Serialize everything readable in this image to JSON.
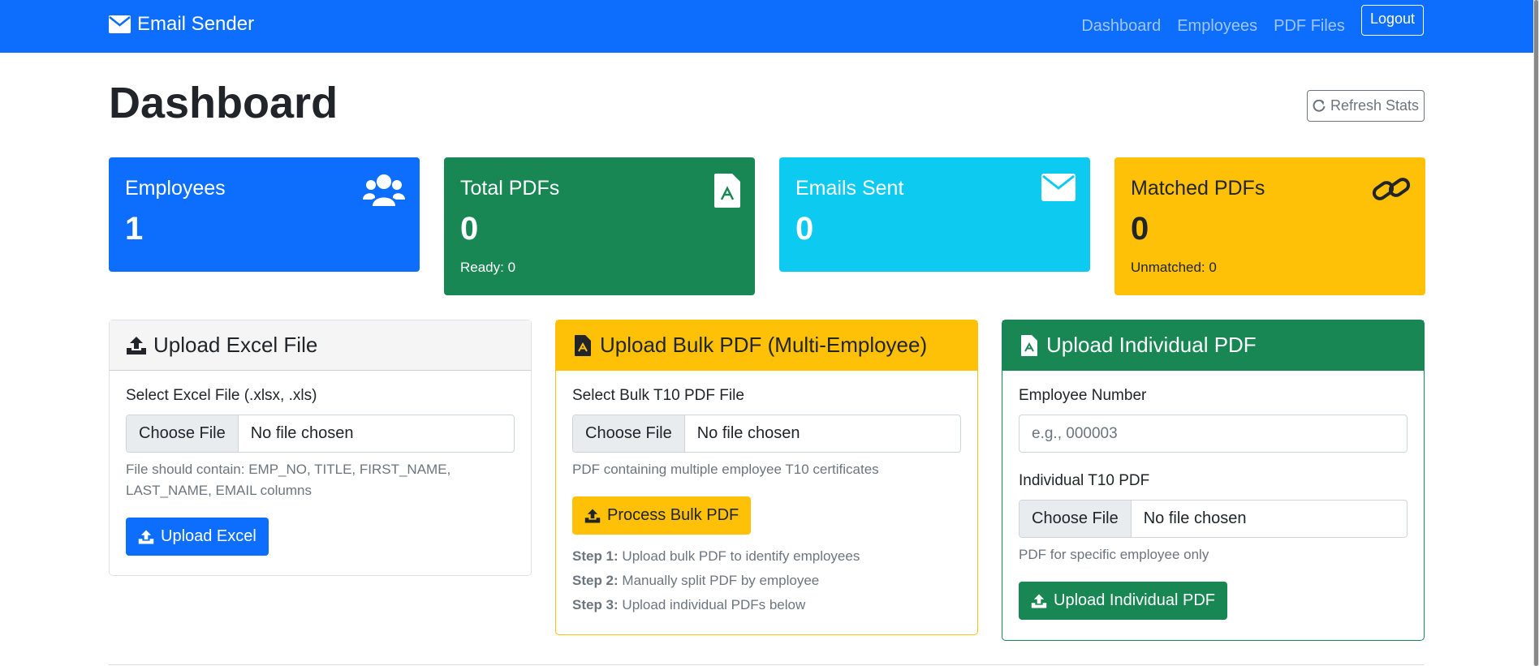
{
  "app": {
    "brand": "Email Sender"
  },
  "nav": {
    "dashboard": "Dashboard",
    "employees": "Employees",
    "pdf_files": "PDF Files",
    "logout": "Logout"
  },
  "page": {
    "title": "Dashboard",
    "refresh": "Refresh Stats"
  },
  "stats": {
    "employees": {
      "label": "Employees",
      "value": "1",
      "color": "#0d6efd"
    },
    "total_pdfs": {
      "label": "Total PDFs",
      "value": "0",
      "sub": "Ready: 0",
      "color": "#198754"
    },
    "emails_sent": {
      "label": "Emails Sent",
      "value": "0",
      "color": "#0dcaf0"
    },
    "matched_pdfs": {
      "label": "Matched PDFs",
      "value": "0",
      "sub": "Unmatched: 0",
      "color": "#ffc107"
    }
  },
  "excel": {
    "title": "Upload Excel File",
    "field_label": "Select Excel File (.xlsx, .xls)",
    "choose": "Choose File",
    "chosen": "No file chosen",
    "help": "File should contain: EMP_NO, TITLE, FIRST_NAME, LAST_NAME, EMAIL columns",
    "button": "Upload Excel"
  },
  "bulk": {
    "title": "Upload Bulk PDF (Multi-Employee)",
    "field_label": "Select Bulk T10 PDF File",
    "choose": "Choose File",
    "chosen": "No file chosen",
    "help": "PDF containing multiple employee T10 certificates",
    "button": "Process Bulk PDF",
    "steps": [
      {
        "label": "Step 1:",
        "text": " Upload bulk PDF to identify employees"
      },
      {
        "label": "Step 2:",
        "text": " Manually split PDF by employee"
      },
      {
        "label": "Step 3:",
        "text": " Upload individual PDFs below"
      }
    ]
  },
  "individual": {
    "title": "Upload Individual PDF",
    "emp_label": "Employee Number",
    "emp_placeholder": "e.g., 000003",
    "pdf_label": "Individual T10 PDF",
    "choose": "Choose File",
    "chosen": "No file chosen",
    "help": "PDF for specific employee only",
    "button": "Upload Individual PDF"
  }
}
